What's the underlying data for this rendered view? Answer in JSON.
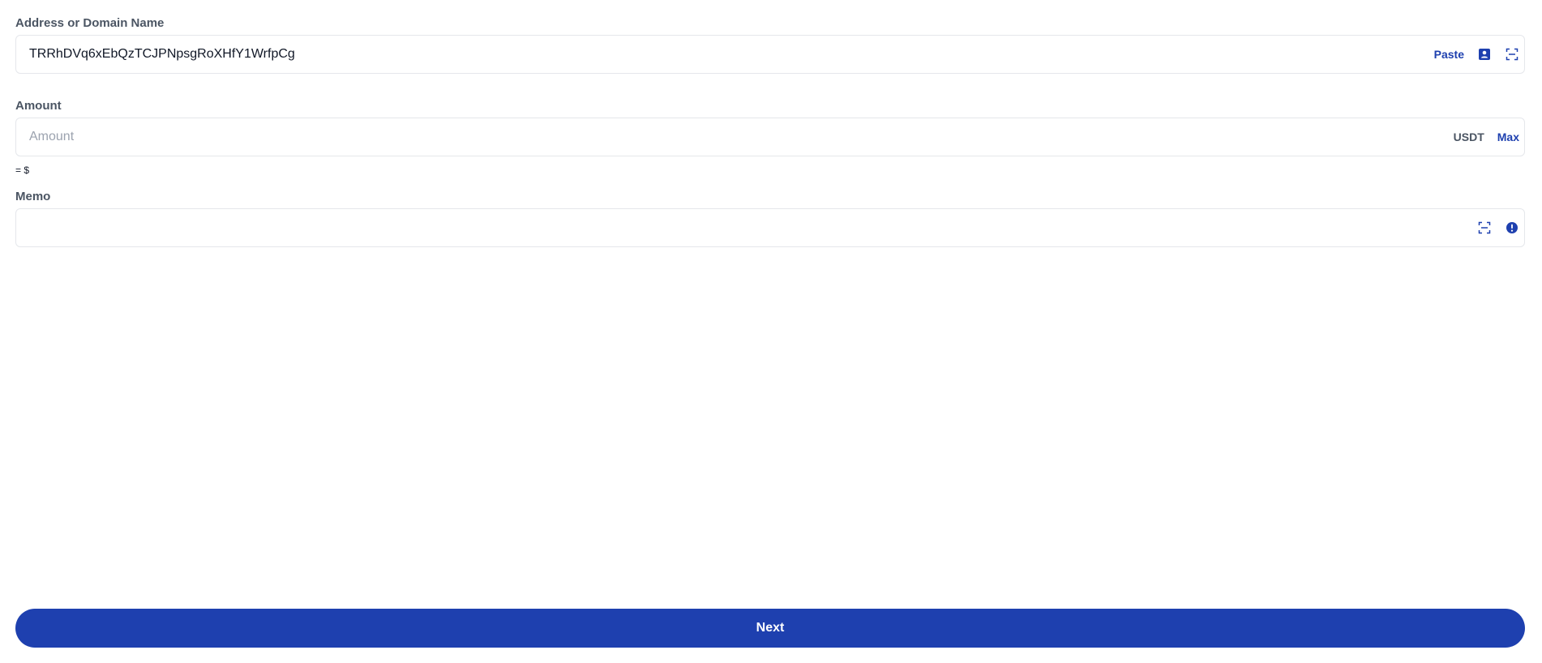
{
  "address": {
    "label": "Address or Domain Name",
    "value": "TRRhDVq6xEbQzTCJPNpsgRoXHfY1WrfpCg",
    "paste_label": "Paste",
    "icons": [
      "address-book-icon",
      "scan-icon"
    ]
  },
  "amount": {
    "label": "Amount",
    "placeholder": "Amount",
    "value": "",
    "unit": "USDT",
    "max_label": "Max",
    "usd_equivalent": "= $"
  },
  "memo": {
    "label": "Memo",
    "value": "",
    "icons": [
      "scan-icon",
      "info-icon"
    ]
  },
  "next_button": {
    "label": "Next"
  },
  "colors": {
    "accent": "#1e40af",
    "label": "#4b5563",
    "border": "#e5e7eb",
    "placeholder": "#9ca3af"
  }
}
